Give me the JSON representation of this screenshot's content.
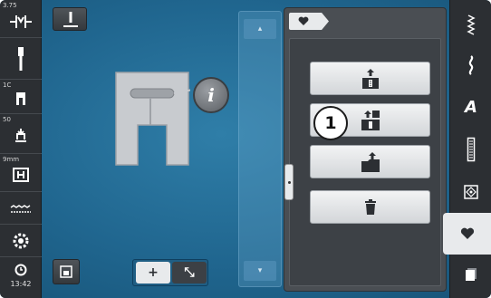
{
  "left_bar": {
    "items": [
      {
        "label": "3.75",
        "icon": "stitch-width-icon"
      },
      {
        "label": "",
        "icon": "needle-icon"
      },
      {
        "label": "1C",
        "icon": "presser-foot-icon"
      },
      {
        "label": "50",
        "icon": "presser-foot-pressure-icon"
      },
      {
        "label": "9mm",
        "icon": "stitch-plate-icon"
      },
      {
        "label": "",
        "icon": "upper-thread-tension-icon"
      },
      {
        "label": "",
        "icon": "bobbin-icon"
      }
    ],
    "clock": "13:42"
  },
  "main": {
    "info_label": "i",
    "zoom": {
      "plus": "+",
      "fit": "⤡"
    }
  },
  "panel": {
    "tab_icon": "heart-icon",
    "actions": [
      {
        "name": "save-to-memory-button",
        "icon": "save-to-memory-icon"
      },
      {
        "name": "overwrite-button",
        "icon": "overwrite-icon"
      },
      {
        "name": "load-button",
        "icon": "load-icon"
      },
      {
        "name": "delete-button",
        "icon": "delete-icon"
      }
    ],
    "callout": "1"
  },
  "right_bar": {
    "items": [
      {
        "name": "practical-stitches-tab",
        "icon": "practical-stitch-icon"
      },
      {
        "name": "decorative-stitches-tab",
        "icon": "decorative-stitch-icon"
      },
      {
        "name": "alphabets-tab",
        "icon": "alphabet-icon",
        "text": "A"
      },
      {
        "name": "buttonholes-tab",
        "icon": "buttonhole-icon"
      },
      {
        "name": "quilt-stitches-tab",
        "icon": "quilt-stitch-icon"
      },
      {
        "name": "personal-program-tab",
        "icon": "heart-icon",
        "active": true
      },
      {
        "name": "clear-screen-tab",
        "icon": "clear-icon"
      }
    ]
  },
  "colors": {
    "background": "#20668f",
    "bar": "#2c2f33",
    "panel": "#4a4e53",
    "active": "#e8eaec"
  }
}
